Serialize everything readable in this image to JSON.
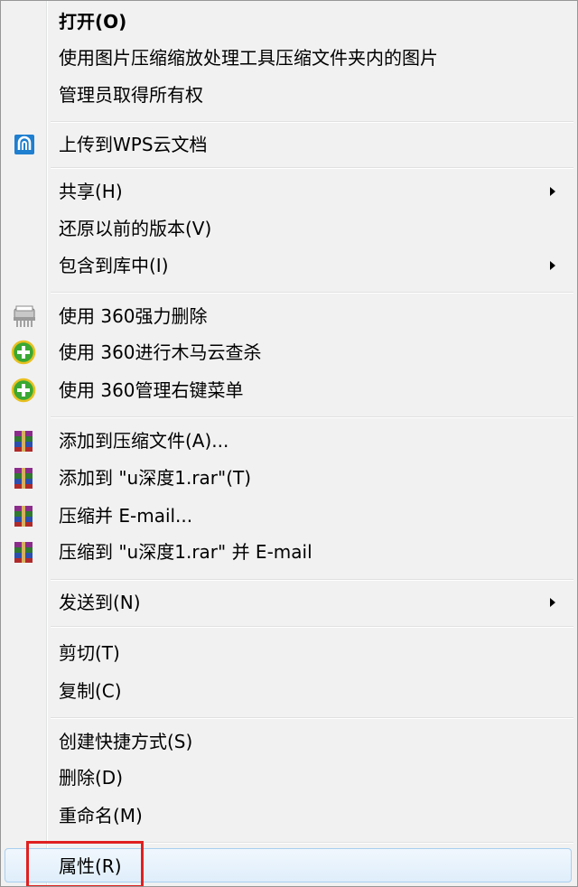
{
  "menu": {
    "items": [
      {
        "label": "打开(O)",
        "bold": true
      },
      {
        "label": "使用图片压缩缩放处理工具压缩文件夹内的图片"
      },
      {
        "label": "管理员取得所有权"
      },
      {
        "label": "上传到WPS云文档",
        "icon": "wps-cloud-icon"
      },
      {
        "label": "共享(H)",
        "submenu": true
      },
      {
        "label": "还原以前的版本(V)"
      },
      {
        "label": "包含到库中(I)",
        "submenu": true
      },
      {
        "label": "使用 360强力删除",
        "icon": "shredder-icon"
      },
      {
        "label": "使用 360进行木马云查杀",
        "icon": "360-plus-icon"
      },
      {
        "label": "使用 360管理右键菜单",
        "icon": "360-plus-icon"
      },
      {
        "label": "添加到压缩文件(A)...",
        "icon": "winrar-icon"
      },
      {
        "label": "添加到 \"u深度1.rar\"(T)",
        "icon": "winrar-icon"
      },
      {
        "label": "压缩并 E-mail...",
        "icon": "winrar-icon"
      },
      {
        "label": "压缩到 \"u深度1.rar\" 并 E-mail",
        "icon": "winrar-icon"
      },
      {
        "label": "发送到(N)",
        "submenu": true
      },
      {
        "label": "剪切(T)"
      },
      {
        "label": "复制(C)"
      },
      {
        "label": "创建快捷方式(S)"
      },
      {
        "label": "删除(D)"
      },
      {
        "label": "重命名(M)"
      },
      {
        "label": "属性(R)",
        "highlighted": true
      }
    ]
  },
  "colors": {
    "highlight_border": "#e02020",
    "wps_icon": "#1f7fd0",
    "plus_icon": "#3aa832"
  }
}
